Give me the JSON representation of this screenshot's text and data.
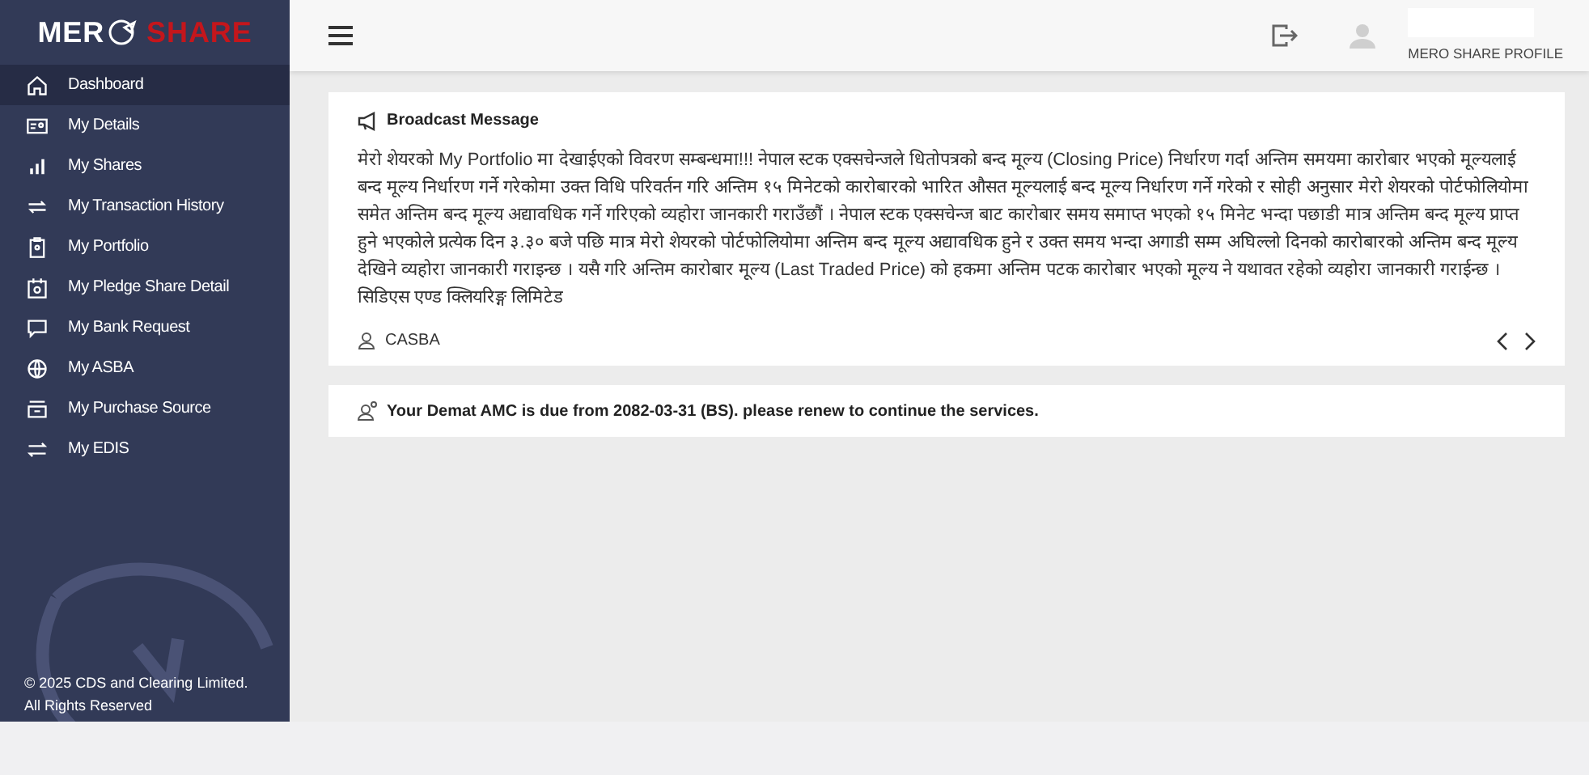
{
  "logo": {
    "left": "MER",
    "right": "SHARE"
  },
  "sidebar": {
    "items": [
      {
        "label": "Dashboard",
        "selected": true
      },
      {
        "label": "My Details",
        "selected": false
      },
      {
        "label": "My Shares",
        "selected": false
      },
      {
        "label": "My Transaction History",
        "selected": false
      },
      {
        "label": "My Portfolio",
        "selected": false
      },
      {
        "label": "My Pledge Share Detail",
        "selected": false
      },
      {
        "label": "My Bank Request",
        "selected": false
      },
      {
        "label": "My ASBA",
        "selected": false
      },
      {
        "label": "My Purchase Source",
        "selected": false
      },
      {
        "label": "My EDIS",
        "selected": false
      }
    ],
    "footer": [
      "© 2025 CDS and Clearing Limited.",
      "All Rights Reserved"
    ]
  },
  "header": {
    "profile_label": "MERO SHARE PROFILE"
  },
  "broadcast": {
    "title": "Broadcast Message",
    "message": "मेरो शेयरको My Portfolio मा देखाईएको विवरण सम्बन्धमा!!! नेपाल स्टक एक्सचेन्जले धितोपत्रको बन्द मूल्य (Closing Price) निर्धारण गर्दा अन्तिम समयमा कारोबार भएको मूल्यलाई बन्द मूल्य निर्धारण गर्ने गरेकोमा उक्त विधि परिवर्तन गरि अन्तिम १५ मिनेटको कारोबारको भारित औसत मूल्यलाई बन्द मूल्य निर्धारण गर्ने गरेको र सोही अनुसार मेरो शेयरको पोर्टफोलियोमा समेत अन्तिम बन्द मूल्य अद्यावधिक गर्ने गरिएको व्यहोरा जानकारी गराउँछौं । नेपाल स्टक एक्सचेन्ज बाट कारोबार समय समाप्त भएको १५ मिनेट भन्दा पछाडी मात्र अन्तिम बन्द मूल्य प्राप्त हुने भएकोले प्रत्येक दिन ३.३० बजे पछि मात्र मेरो शेयरको पोर्टफोलियोमा अन्तिम बन्द मूल्य अद्यावधिक हुने र उक्त समय भन्दा अगाडी सम्म अघिल्लो दिनको कारोबारको अन्तिम बन्द मूल्य देखिने व्यहोरा जानकारी गराइन्छ । यसै गरि अन्तिम कारोबार मूल्य (Last Traded Price) को हकमा अन्तिम पटक कारोबार भएको मूल्य ने यथावत रहेको व्यहोरा जानकारी गराईन्छ । सिडिएस एण्ड क्लियरिङ्ग लिमिटेड",
    "author": "CASBA"
  },
  "notice": {
    "text": "Your Demat AMC is due from 2082-03-31 (BS). please renew to continue the services."
  }
}
